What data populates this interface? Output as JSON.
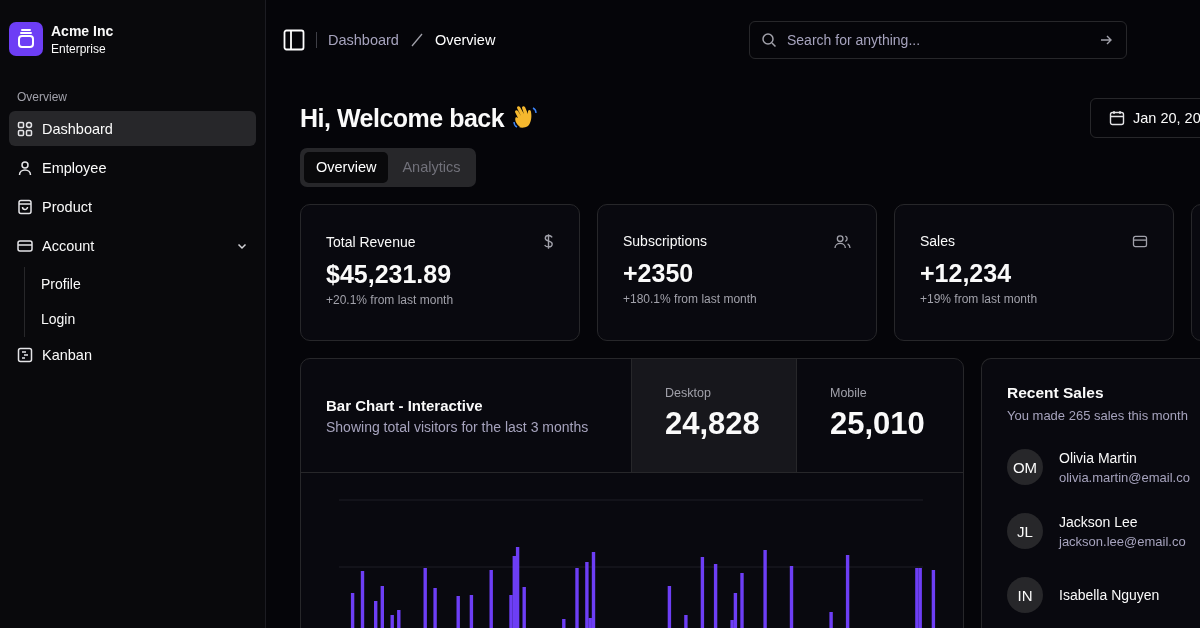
{
  "brand": {
    "name": "Acme Inc",
    "plan": "Enterprise"
  },
  "sidebar": {
    "group_label": "Overview",
    "items": [
      {
        "label": "Dashboard",
        "selected": true
      },
      {
        "label": "Employee",
        "selected": false
      },
      {
        "label": "Product",
        "selected": false
      },
      {
        "label": "Account",
        "selected": false,
        "expanded": true,
        "children": [
          {
            "label": "Profile",
            "selected": false
          },
          {
            "label": "Login",
            "selected": false
          }
        ]
      },
      {
        "label": "Kanban",
        "selected": false
      }
    ]
  },
  "breadcrumb": [
    "Dashboard",
    "Overview"
  ],
  "search": {
    "placeholder": "Search for anything..."
  },
  "heading": "Hi, Welcome back",
  "date_button": "Jan 20, 20",
  "tabs": [
    {
      "label": "Overview",
      "selected": true
    },
    {
      "label": "Analytics",
      "selected": false
    }
  ],
  "stats": [
    {
      "title": "Total Revenue",
      "value": "$45,231.89",
      "note": "+20.1% from last month"
    },
    {
      "title": "Subscriptions",
      "value": "+2350",
      "note": "+180.1% from last month"
    },
    {
      "title": "Sales",
      "value": "+12,234",
      "note": "+19% from last month"
    }
  ],
  "chart_card": {
    "title": "Bar Chart - Interactive",
    "subtitle": "Showing total visitors for the last 3 months",
    "metrics": [
      {
        "label": "Desktop",
        "value": "24,828",
        "selected": true
      },
      {
        "label": "Mobile",
        "value": "25,010",
        "selected": false
      }
    ]
  },
  "recent_sales": {
    "title": "Recent Sales",
    "subtitle": "You made 265 sales this month",
    "people": [
      {
        "initials": "OM",
        "name": "Olivia Martin",
        "email": "olivia.martin@email.co"
      },
      {
        "initials": "JL",
        "name": "Jackson Lee",
        "email": "jackson.lee@email.co"
      },
      {
        "initials": "IN",
        "name": "Isabella Nguyen"
      }
    ]
  }
}
